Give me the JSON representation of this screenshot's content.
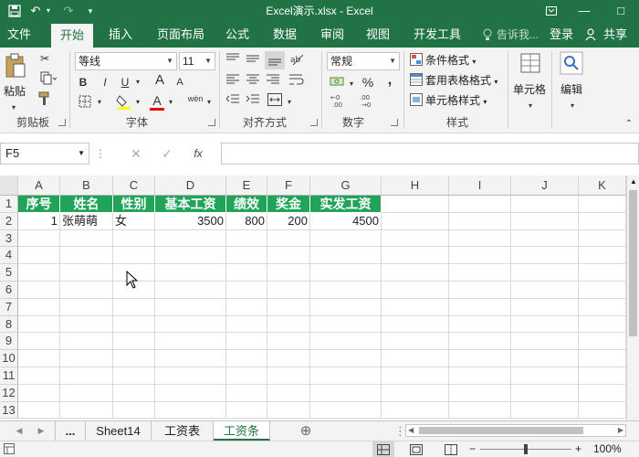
{
  "window": {
    "title": "Excel演示.xlsx - Excel"
  },
  "ribbon_tabs": [
    "文件",
    "开始",
    "插入",
    "页面布局",
    "公式",
    "数据",
    "审阅",
    "视图",
    "开发工具"
  ],
  "active_tab": "开始",
  "tell_me": "告诉我...",
  "login": "登录",
  "share": "共享",
  "clipboard": {
    "paste": "粘贴",
    "label": "剪贴板"
  },
  "font": {
    "name": "等线",
    "size": "11",
    "label": "字体",
    "bold": "B",
    "italic": "I",
    "underline": "U",
    "grow": "A",
    "shrink": "A",
    "color": "A",
    "phonetic": "wén"
  },
  "alignment": {
    "label": "对齐方式"
  },
  "number": {
    "format": "常规",
    "label": "数字",
    "percent": "%",
    "comma": ","
  },
  "styles": {
    "conditional": "条件格式",
    "table": "套用表格格式",
    "cell": "单元格样式",
    "label": "样式"
  },
  "cells": {
    "label": "单元格"
  },
  "editing": {
    "label": "编辑"
  },
  "name_box": "F5",
  "fx": "fx",
  "columns": [
    "A",
    "B",
    "C",
    "D",
    "E",
    "F",
    "G",
    "H",
    "I",
    "J",
    "K"
  ],
  "rows": [
    "1",
    "2",
    "3",
    "4",
    "5",
    "6",
    "7",
    "8",
    "9",
    "10",
    "11",
    "12",
    "13"
  ],
  "table": {
    "headers": [
      "序号",
      "姓名",
      "性别",
      "基本工资",
      "绩效",
      "奖金",
      "实发工资"
    ],
    "row": [
      "1",
      "张萌萌",
      "女",
      "3500",
      "800",
      "200",
      "4500"
    ]
  },
  "sheets": [
    "...",
    "Sheet14",
    "工资表",
    "工资条"
  ],
  "active_sheet": "工资条",
  "zoom": "100%"
}
